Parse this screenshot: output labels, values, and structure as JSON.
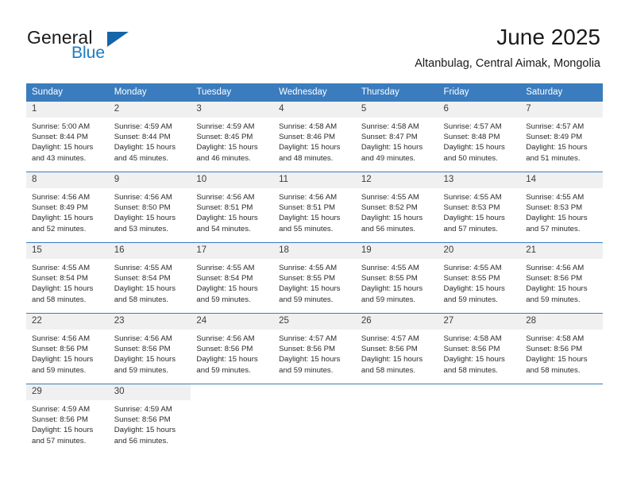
{
  "brand": {
    "name_part1": "General",
    "name_part2": "Blue",
    "mark_icon": "triangle-logo-icon",
    "primary_color": "#1a7bc4"
  },
  "header": {
    "month_title": "June 2025",
    "location": "Altanbulag, Central Aimak, Mongolia"
  },
  "calendar": {
    "header_color": "#3a7cbe",
    "daynum_band_color": "#f0f0f0",
    "weekday_headers": [
      "Sunday",
      "Monday",
      "Tuesday",
      "Wednesday",
      "Thursday",
      "Friday",
      "Saturday"
    ],
    "weeks": [
      [
        {
          "day": "1",
          "sunrise": "Sunrise: 5:00 AM",
          "sunset": "Sunset: 8:44 PM",
          "daylight": "Daylight: 15 hours and 43 minutes."
        },
        {
          "day": "2",
          "sunrise": "Sunrise: 4:59 AM",
          "sunset": "Sunset: 8:44 PM",
          "daylight": "Daylight: 15 hours and 45 minutes."
        },
        {
          "day": "3",
          "sunrise": "Sunrise: 4:59 AM",
          "sunset": "Sunset: 8:45 PM",
          "daylight": "Daylight: 15 hours and 46 minutes."
        },
        {
          "day": "4",
          "sunrise": "Sunrise: 4:58 AM",
          "sunset": "Sunset: 8:46 PM",
          "daylight": "Daylight: 15 hours and 48 minutes."
        },
        {
          "day": "5",
          "sunrise": "Sunrise: 4:58 AM",
          "sunset": "Sunset: 8:47 PM",
          "daylight": "Daylight: 15 hours and 49 minutes."
        },
        {
          "day": "6",
          "sunrise": "Sunrise: 4:57 AM",
          "sunset": "Sunset: 8:48 PM",
          "daylight": "Daylight: 15 hours and 50 minutes."
        },
        {
          "day": "7",
          "sunrise": "Sunrise: 4:57 AM",
          "sunset": "Sunset: 8:49 PM",
          "daylight": "Daylight: 15 hours and 51 minutes."
        }
      ],
      [
        {
          "day": "8",
          "sunrise": "Sunrise: 4:56 AM",
          "sunset": "Sunset: 8:49 PM",
          "daylight": "Daylight: 15 hours and 52 minutes."
        },
        {
          "day": "9",
          "sunrise": "Sunrise: 4:56 AM",
          "sunset": "Sunset: 8:50 PM",
          "daylight": "Daylight: 15 hours and 53 minutes."
        },
        {
          "day": "10",
          "sunrise": "Sunrise: 4:56 AM",
          "sunset": "Sunset: 8:51 PM",
          "daylight": "Daylight: 15 hours and 54 minutes."
        },
        {
          "day": "11",
          "sunrise": "Sunrise: 4:56 AM",
          "sunset": "Sunset: 8:51 PM",
          "daylight": "Daylight: 15 hours and 55 minutes."
        },
        {
          "day": "12",
          "sunrise": "Sunrise: 4:55 AM",
          "sunset": "Sunset: 8:52 PM",
          "daylight": "Daylight: 15 hours and 56 minutes."
        },
        {
          "day": "13",
          "sunrise": "Sunrise: 4:55 AM",
          "sunset": "Sunset: 8:53 PM",
          "daylight": "Daylight: 15 hours and 57 minutes."
        },
        {
          "day": "14",
          "sunrise": "Sunrise: 4:55 AM",
          "sunset": "Sunset: 8:53 PM",
          "daylight": "Daylight: 15 hours and 57 minutes."
        }
      ],
      [
        {
          "day": "15",
          "sunrise": "Sunrise: 4:55 AM",
          "sunset": "Sunset: 8:54 PM",
          "daylight": "Daylight: 15 hours and 58 minutes."
        },
        {
          "day": "16",
          "sunrise": "Sunrise: 4:55 AM",
          "sunset": "Sunset: 8:54 PM",
          "daylight": "Daylight: 15 hours and 58 minutes."
        },
        {
          "day": "17",
          "sunrise": "Sunrise: 4:55 AM",
          "sunset": "Sunset: 8:54 PM",
          "daylight": "Daylight: 15 hours and 59 minutes."
        },
        {
          "day": "18",
          "sunrise": "Sunrise: 4:55 AM",
          "sunset": "Sunset: 8:55 PM",
          "daylight": "Daylight: 15 hours and 59 minutes."
        },
        {
          "day": "19",
          "sunrise": "Sunrise: 4:55 AM",
          "sunset": "Sunset: 8:55 PM",
          "daylight": "Daylight: 15 hours and 59 minutes."
        },
        {
          "day": "20",
          "sunrise": "Sunrise: 4:55 AM",
          "sunset": "Sunset: 8:55 PM",
          "daylight": "Daylight: 15 hours and 59 minutes."
        },
        {
          "day": "21",
          "sunrise": "Sunrise: 4:56 AM",
          "sunset": "Sunset: 8:56 PM",
          "daylight": "Daylight: 15 hours and 59 minutes."
        }
      ],
      [
        {
          "day": "22",
          "sunrise": "Sunrise: 4:56 AM",
          "sunset": "Sunset: 8:56 PM",
          "daylight": "Daylight: 15 hours and 59 minutes."
        },
        {
          "day": "23",
          "sunrise": "Sunrise: 4:56 AM",
          "sunset": "Sunset: 8:56 PM",
          "daylight": "Daylight: 15 hours and 59 minutes."
        },
        {
          "day": "24",
          "sunrise": "Sunrise: 4:56 AM",
          "sunset": "Sunset: 8:56 PM",
          "daylight": "Daylight: 15 hours and 59 minutes."
        },
        {
          "day": "25",
          "sunrise": "Sunrise: 4:57 AM",
          "sunset": "Sunset: 8:56 PM",
          "daylight": "Daylight: 15 hours and 59 minutes."
        },
        {
          "day": "26",
          "sunrise": "Sunrise: 4:57 AM",
          "sunset": "Sunset: 8:56 PM",
          "daylight": "Daylight: 15 hours and 58 minutes."
        },
        {
          "day": "27",
          "sunrise": "Sunrise: 4:58 AM",
          "sunset": "Sunset: 8:56 PM",
          "daylight": "Daylight: 15 hours and 58 minutes."
        },
        {
          "day": "28",
          "sunrise": "Sunrise: 4:58 AM",
          "sunset": "Sunset: 8:56 PM",
          "daylight": "Daylight: 15 hours and 58 minutes."
        }
      ],
      [
        {
          "day": "29",
          "sunrise": "Sunrise: 4:59 AM",
          "sunset": "Sunset: 8:56 PM",
          "daylight": "Daylight: 15 hours and 57 minutes."
        },
        {
          "day": "30",
          "sunrise": "Sunrise: 4:59 AM",
          "sunset": "Sunset: 8:56 PM",
          "daylight": "Daylight: 15 hours and 56 minutes."
        },
        {
          "day": "",
          "sunrise": "",
          "sunset": "",
          "daylight": ""
        },
        {
          "day": "",
          "sunrise": "",
          "sunset": "",
          "daylight": ""
        },
        {
          "day": "",
          "sunrise": "",
          "sunset": "",
          "daylight": ""
        },
        {
          "day": "",
          "sunrise": "",
          "sunset": "",
          "daylight": ""
        },
        {
          "day": "",
          "sunrise": "",
          "sunset": "",
          "daylight": ""
        }
      ]
    ]
  }
}
